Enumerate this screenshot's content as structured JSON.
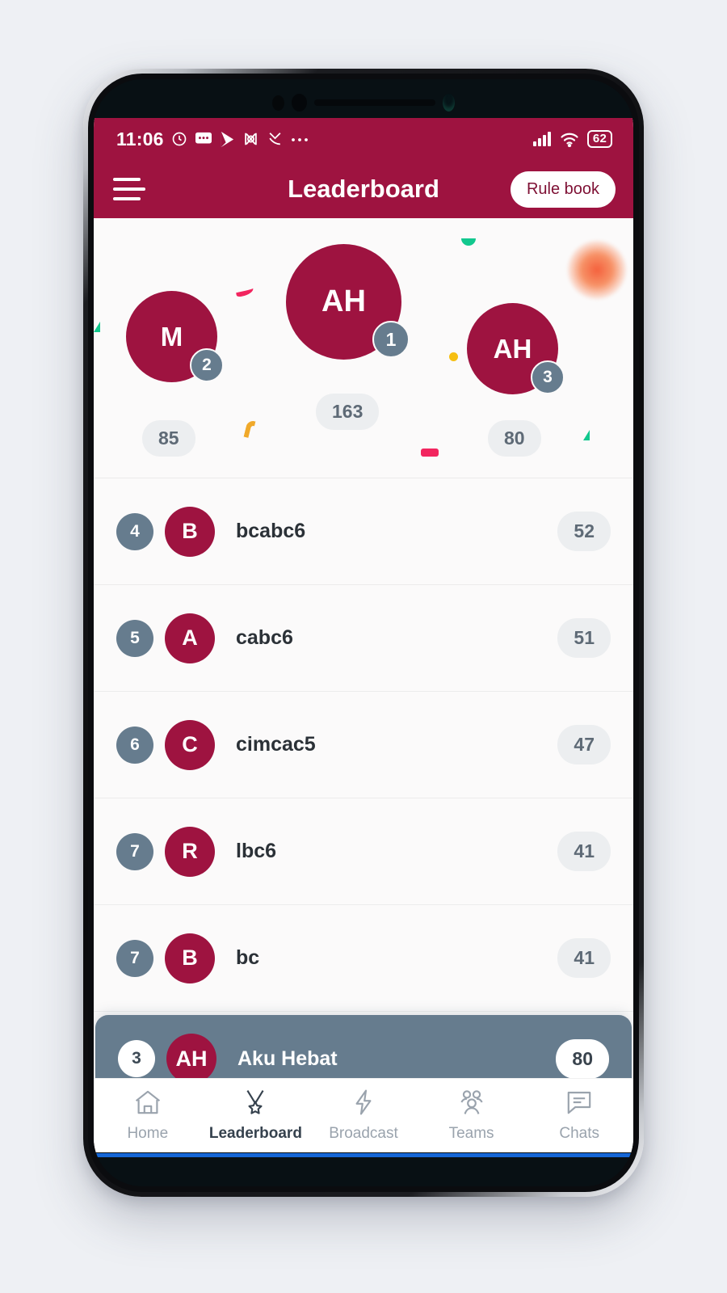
{
  "colors": {
    "brand": "#9e1340",
    "slate": "#667c8e",
    "pill_bg": "#eceef0",
    "page_bg": "#eef0f4"
  },
  "statusbar": {
    "time": "11:06",
    "icons": [
      "clock-icon",
      "message-icon",
      "play-store-icon",
      "no-notification-icon",
      "call-missed-icon",
      "more-icon"
    ],
    "signal": "signal-icon",
    "wifi": "wifi-icon",
    "battery": "62"
  },
  "header": {
    "menu": "hamburger-menu-icon",
    "title": "Leaderboard",
    "rule_book_label": "Rule book"
  },
  "podium": [
    {
      "rank": "1",
      "initials": "AH",
      "score": "163"
    },
    {
      "rank": "2",
      "initials": "M",
      "score": "85"
    },
    {
      "rank": "3",
      "initials": "AH",
      "score": "80"
    }
  ],
  "rows": [
    {
      "rank": "4",
      "initials": "B",
      "name": "bcabc6",
      "score": "52"
    },
    {
      "rank": "5",
      "initials": "A",
      "name": "cabc6",
      "score": "51"
    },
    {
      "rank": "6",
      "initials": "C",
      "name": "cimcac5",
      "score": "47"
    },
    {
      "rank": "7",
      "initials": "R",
      "name": "lbc6",
      "score": "41"
    },
    {
      "rank": "7",
      "initials": "B",
      "name": "bc",
      "score": "41"
    }
  ],
  "current_user": {
    "rank": "3",
    "initials": "AH",
    "name": "Aku Hebat",
    "score": "80"
  },
  "bottom_nav": [
    {
      "label": "Home",
      "icon": "home-icon",
      "active": false
    },
    {
      "label": "Leaderboard",
      "icon": "medal-icon",
      "active": true
    },
    {
      "label": "Broadcast",
      "icon": "bolt-icon",
      "active": false
    },
    {
      "label": "Teams",
      "icon": "people-icon",
      "active": false
    },
    {
      "label": "Chats",
      "icon": "chat-icon",
      "active": false
    }
  ]
}
